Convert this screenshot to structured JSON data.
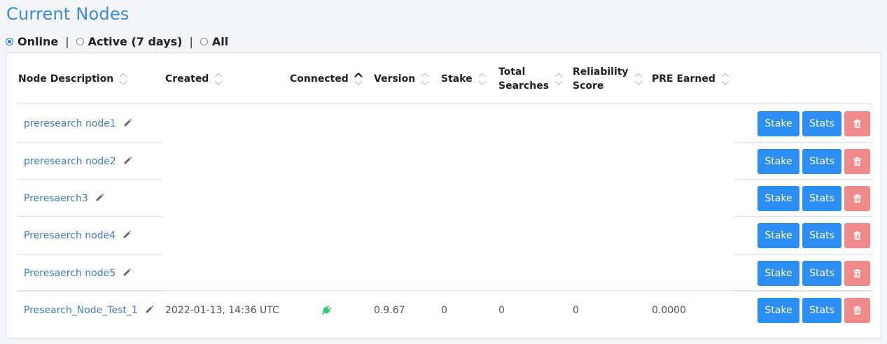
{
  "page": {
    "title": "Current Nodes"
  },
  "filters": [
    {
      "label": "Online",
      "checked": true
    },
    {
      "label": "Active (7 days)",
      "checked": false
    },
    {
      "label": "All",
      "checked": false
    }
  ],
  "filter_separator": "|",
  "table": {
    "columns": [
      {
        "line1": "Node Description",
        "line2": "",
        "sort": "none"
      },
      {
        "line1": "Created",
        "line2": "",
        "sort": "none"
      },
      {
        "line1": "Connected",
        "line2": "",
        "sort": "asc"
      },
      {
        "line1": "Version",
        "line2": "",
        "sort": "none"
      },
      {
        "line1": "Stake",
        "line2": "",
        "sort": "none"
      },
      {
        "line1": "Total",
        "line2": "Searches",
        "sort": "none"
      },
      {
        "line1": "Reliability",
        "line2": "Score",
        "sort": "none"
      },
      {
        "line1": "PRE Earned",
        "line2": "",
        "sort": "none"
      }
    ],
    "rows": [
      {
        "description": "preresearch node1",
        "created": "",
        "connected": false,
        "version": "",
        "stake": "",
        "total_searches": "",
        "reliability": "",
        "pre_earned": ""
      },
      {
        "description": "preresearch node2",
        "created": "",
        "connected": false,
        "version": "",
        "stake": "",
        "total_searches": "",
        "reliability": "",
        "pre_earned": ""
      },
      {
        "description": "Preresaerch3",
        "created": "",
        "connected": false,
        "version": "",
        "stake": "",
        "total_searches": "",
        "reliability": "",
        "pre_earned": ""
      },
      {
        "description": "Preresaerch node4",
        "created": "",
        "connected": false,
        "version": "",
        "stake": "",
        "total_searches": "",
        "reliability": "",
        "pre_earned": ""
      },
      {
        "description": "Preresaerch node5",
        "created": "",
        "connected": false,
        "version": "",
        "stake": "",
        "total_searches": "",
        "reliability": "",
        "pre_earned": ""
      },
      {
        "description": "Presearch_Node_Test_1",
        "created": "2022-01-13, 14:36 UTC",
        "connected": true,
        "version": "0.9.67",
        "stake": "0",
        "total_searches": "0",
        "reliability": "0",
        "pre_earned": "0.0000"
      }
    ]
  },
  "actions": {
    "stake_label": "Stake",
    "stats_label": "Stats"
  },
  "icons": {
    "edit": "pencil-icon",
    "delete": "trash-icon",
    "connected": "plug-icon",
    "sort": "sort-chevrons-icon"
  },
  "colors": {
    "primary": "#2c8df2",
    "danger": "#f08a8a",
    "link": "#3d7cc9",
    "title": "#3a8be0",
    "connected": "#2ecc71"
  }
}
